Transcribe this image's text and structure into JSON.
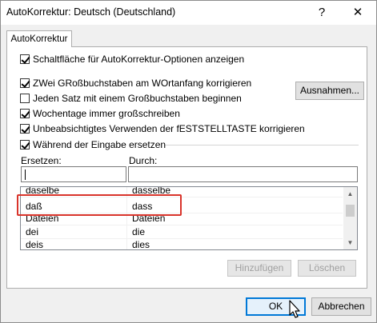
{
  "window": {
    "title": "AutoKorrektur: Deutsch (Deutschland)",
    "help_glyph": "?",
    "close_glyph": "✕"
  },
  "tabs": [
    {
      "label": "AutoKorrektur"
    }
  ],
  "options": {
    "show_buttons": {
      "label": "Schaltfläche für AutoKorrektur-Optionen anzeigen",
      "checked": true
    },
    "two_caps": {
      "label": "ZWei GRoßbuchstaben am WOrtanfang korrigieren",
      "checked": true
    },
    "sentence_caps": {
      "label": "Jeden Satz mit einem Großbuchstaben beginnen",
      "checked": false
    },
    "weekdays": {
      "label": "Wochentage immer großschreiben",
      "checked": true
    },
    "capslock": {
      "label": "Unbeabsichtigtes Verwenden der fESTSTELLTASTE korrigieren",
      "checked": true
    },
    "replace_typing": {
      "label": "Während der Eingabe ersetzen",
      "checked": true
    }
  },
  "exceptions_button": "Ausnahmen...",
  "replace": {
    "replace_label": "Ersetzen:",
    "with_label": "Durch:",
    "replace_value": "",
    "with_value": ""
  },
  "list": {
    "rows": [
      {
        "from": "daselbe",
        "to": "dasselbe"
      },
      {
        "from": "daß",
        "to": "dass"
      },
      {
        "from": "Dateien",
        "to": "Dateien"
      },
      {
        "from": "dei",
        "to": "die"
      },
      {
        "from": "deis",
        "to": "dies"
      }
    ],
    "highlighted_row": 1
  },
  "buttons": {
    "add": "Hinzufügen",
    "delete": "Löschen",
    "ok": "OK",
    "cancel": "Abbrechen"
  }
}
